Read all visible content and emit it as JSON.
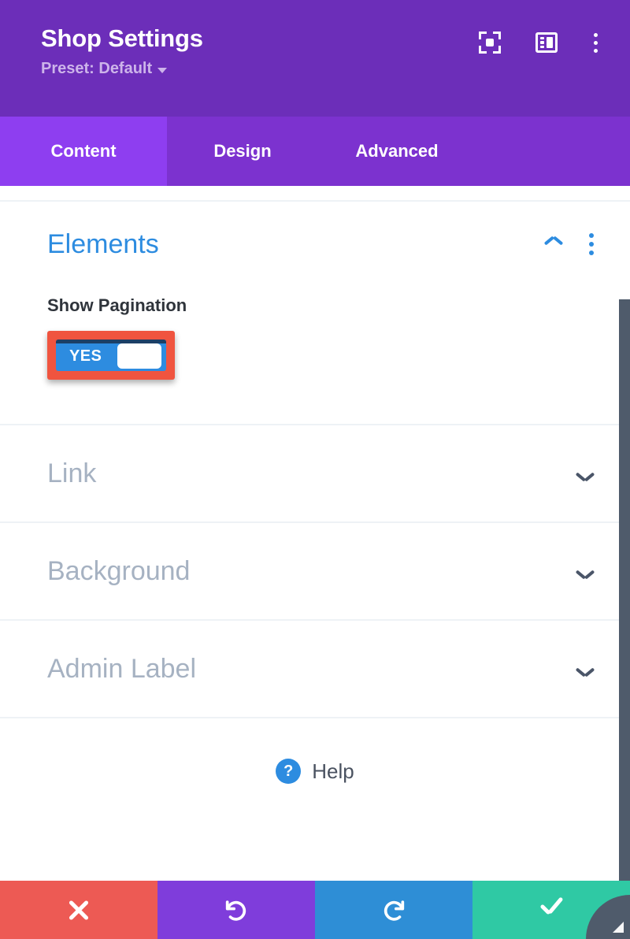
{
  "header": {
    "title": "Shop Settings",
    "preset_label": "Preset: Default",
    "icons": {
      "focus": "focus-target-icon",
      "panel": "panel-layout-icon",
      "more": "more-vertical-icon"
    }
  },
  "tabs": [
    {
      "label": "Content",
      "active": true
    },
    {
      "label": "Design",
      "active": false
    },
    {
      "label": "Advanced",
      "active": false
    }
  ],
  "sections": {
    "elements": {
      "title": "Elements",
      "expanded": true,
      "fields": [
        {
          "label": "Show Pagination",
          "type": "toggle",
          "value": "YES",
          "highlighted": true
        }
      ]
    },
    "collapsed": [
      {
        "title": "Link"
      },
      {
        "title": "Background"
      },
      {
        "title": "Admin Label"
      }
    ]
  },
  "help": {
    "badge": "?",
    "label": "Help"
  },
  "footer": {
    "buttons": [
      {
        "name": "cancel",
        "glyph": "close-x-icon",
        "color": "#ed5a54"
      },
      {
        "name": "undo",
        "glyph": "undo-icon",
        "color": "#7f3ddb"
      },
      {
        "name": "redo",
        "glyph": "redo-icon",
        "color": "#2e8ed6"
      },
      {
        "name": "save",
        "glyph": "checkmark-icon",
        "color": "#2fc9a4"
      }
    ]
  },
  "colors": {
    "header_purple": "#6c2eb9",
    "tabbar_purple": "#7c32cf",
    "active_tab_purple": "#8e3ef0",
    "accent_blue": "#2d8ce0",
    "highlight_red": "#f0543f",
    "muted_gray": "#a6b2c2",
    "scrollbar": "#4f5b6b"
  }
}
